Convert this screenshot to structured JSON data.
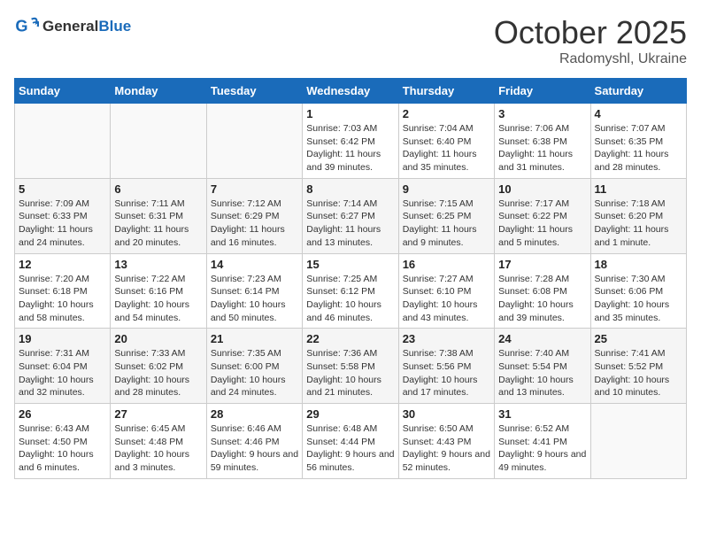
{
  "header": {
    "logo_general": "General",
    "logo_blue": "Blue",
    "month": "October 2025",
    "location": "Radomyshl, Ukraine"
  },
  "weekdays": [
    "Sunday",
    "Monday",
    "Tuesday",
    "Wednesday",
    "Thursday",
    "Friday",
    "Saturday"
  ],
  "weeks": [
    [
      {
        "day": "",
        "info": ""
      },
      {
        "day": "",
        "info": ""
      },
      {
        "day": "",
        "info": ""
      },
      {
        "day": "1",
        "info": "Sunrise: 7:03 AM\nSunset: 6:42 PM\nDaylight: 11 hours\nand 39 minutes."
      },
      {
        "day": "2",
        "info": "Sunrise: 7:04 AM\nSunset: 6:40 PM\nDaylight: 11 hours\nand 35 minutes."
      },
      {
        "day": "3",
        "info": "Sunrise: 7:06 AM\nSunset: 6:38 PM\nDaylight: 11 hours\nand 31 minutes."
      },
      {
        "day": "4",
        "info": "Sunrise: 7:07 AM\nSunset: 6:35 PM\nDaylight: 11 hours\nand 28 minutes."
      }
    ],
    [
      {
        "day": "5",
        "info": "Sunrise: 7:09 AM\nSunset: 6:33 PM\nDaylight: 11 hours\nand 24 minutes."
      },
      {
        "day": "6",
        "info": "Sunrise: 7:11 AM\nSunset: 6:31 PM\nDaylight: 11 hours\nand 20 minutes."
      },
      {
        "day": "7",
        "info": "Sunrise: 7:12 AM\nSunset: 6:29 PM\nDaylight: 11 hours\nand 16 minutes."
      },
      {
        "day": "8",
        "info": "Sunrise: 7:14 AM\nSunset: 6:27 PM\nDaylight: 11 hours\nand 13 minutes."
      },
      {
        "day": "9",
        "info": "Sunrise: 7:15 AM\nSunset: 6:25 PM\nDaylight: 11 hours\nand 9 minutes."
      },
      {
        "day": "10",
        "info": "Sunrise: 7:17 AM\nSunset: 6:22 PM\nDaylight: 11 hours\nand 5 minutes."
      },
      {
        "day": "11",
        "info": "Sunrise: 7:18 AM\nSunset: 6:20 PM\nDaylight: 11 hours\nand 1 minute."
      }
    ],
    [
      {
        "day": "12",
        "info": "Sunrise: 7:20 AM\nSunset: 6:18 PM\nDaylight: 10 hours\nand 58 minutes."
      },
      {
        "day": "13",
        "info": "Sunrise: 7:22 AM\nSunset: 6:16 PM\nDaylight: 10 hours\nand 54 minutes."
      },
      {
        "day": "14",
        "info": "Sunrise: 7:23 AM\nSunset: 6:14 PM\nDaylight: 10 hours\nand 50 minutes."
      },
      {
        "day": "15",
        "info": "Sunrise: 7:25 AM\nSunset: 6:12 PM\nDaylight: 10 hours\nand 46 minutes."
      },
      {
        "day": "16",
        "info": "Sunrise: 7:27 AM\nSunset: 6:10 PM\nDaylight: 10 hours\nand 43 minutes."
      },
      {
        "day": "17",
        "info": "Sunrise: 7:28 AM\nSunset: 6:08 PM\nDaylight: 10 hours\nand 39 minutes."
      },
      {
        "day": "18",
        "info": "Sunrise: 7:30 AM\nSunset: 6:06 PM\nDaylight: 10 hours\nand 35 minutes."
      }
    ],
    [
      {
        "day": "19",
        "info": "Sunrise: 7:31 AM\nSunset: 6:04 PM\nDaylight: 10 hours\nand 32 minutes."
      },
      {
        "day": "20",
        "info": "Sunrise: 7:33 AM\nSunset: 6:02 PM\nDaylight: 10 hours\nand 28 minutes."
      },
      {
        "day": "21",
        "info": "Sunrise: 7:35 AM\nSunset: 6:00 PM\nDaylight: 10 hours\nand 24 minutes."
      },
      {
        "day": "22",
        "info": "Sunrise: 7:36 AM\nSunset: 5:58 PM\nDaylight: 10 hours\nand 21 minutes."
      },
      {
        "day": "23",
        "info": "Sunrise: 7:38 AM\nSunset: 5:56 PM\nDaylight: 10 hours\nand 17 minutes."
      },
      {
        "day": "24",
        "info": "Sunrise: 7:40 AM\nSunset: 5:54 PM\nDaylight: 10 hours\nand 13 minutes."
      },
      {
        "day": "25",
        "info": "Sunrise: 7:41 AM\nSunset: 5:52 PM\nDaylight: 10 hours\nand 10 minutes."
      }
    ],
    [
      {
        "day": "26",
        "info": "Sunrise: 6:43 AM\nSunset: 4:50 PM\nDaylight: 10 hours\nand 6 minutes."
      },
      {
        "day": "27",
        "info": "Sunrise: 6:45 AM\nSunset: 4:48 PM\nDaylight: 10 hours\nand 3 minutes."
      },
      {
        "day": "28",
        "info": "Sunrise: 6:46 AM\nSunset: 4:46 PM\nDaylight: 9 hours\nand 59 minutes."
      },
      {
        "day": "29",
        "info": "Sunrise: 6:48 AM\nSunset: 4:44 PM\nDaylight: 9 hours\nand 56 minutes."
      },
      {
        "day": "30",
        "info": "Sunrise: 6:50 AM\nSunset: 4:43 PM\nDaylight: 9 hours\nand 52 minutes."
      },
      {
        "day": "31",
        "info": "Sunrise: 6:52 AM\nSunset: 4:41 PM\nDaylight: 9 hours\nand 49 minutes."
      },
      {
        "day": "",
        "info": ""
      }
    ]
  ]
}
